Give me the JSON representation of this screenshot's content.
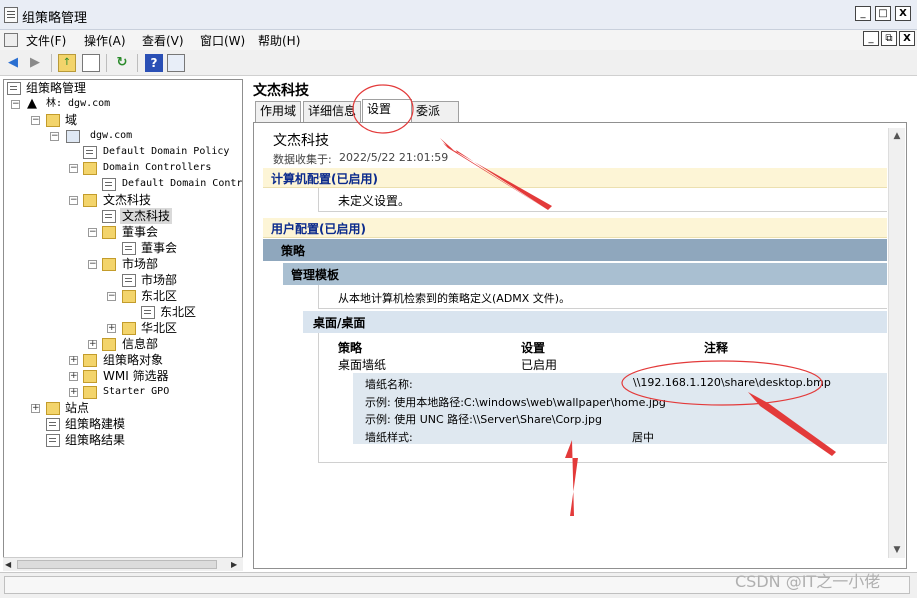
{
  "window": {
    "title": "组策略管理",
    "minimize": "_",
    "maximize": "□",
    "close": "X"
  },
  "menu": {
    "items": [
      "文件(F)",
      "操作(A)",
      "查看(V)",
      "窗口(W)",
      "帮助(H)"
    ],
    "child_minimize": "_",
    "child_restore": "⧉",
    "child_close": "X"
  },
  "toolbar": {
    "icons": [
      "back-arrow-icon",
      "forward-arrow-icon",
      "up-folder-icon",
      "show-tree-icon",
      "refresh-icon",
      "help-icon",
      "properties-icon"
    ]
  },
  "tree": {
    "root": "组策略管理",
    "forest": "林: dgw.com",
    "domains": "域",
    "domain": "dgw.com",
    "default_domain_policy": "Default Domain Policy",
    "domain_controllers": "Domain Controllers",
    "default_domain_controllers_policy": "Default Domain Contr",
    "ou_wenjie": "文杰科技",
    "gpo_wenjie": "文杰科技",
    "ou_board": "董事会",
    "gpo_board": "董事会",
    "ou_market": "市场部",
    "gpo_market": "市场部",
    "ou_northeast": "东北区",
    "gpo_northeast": "东北区",
    "ou_northchina": "华北区",
    "ou_it": "信息部",
    "gpo_objects": "组策略对象",
    "wmi_filters": "WMI 筛选器",
    "starter_gpo": "Starter GPO",
    "sites": "站点",
    "modeling": "组策略建模",
    "results": "组策略结果"
  },
  "details": {
    "title": "文杰科技",
    "tabs": [
      "作用域",
      "详细信息",
      "设置",
      "委派"
    ],
    "active_tab": "设置",
    "report": {
      "title": "文杰科技",
      "collected_label": "数据收集于:",
      "collected_time": "2022/5/22 21:01:59",
      "computer_section": "计算机配置(已启用)",
      "computer_none": "未定义设置。",
      "user_section": "用户配置(已启用)",
      "policies": "策略",
      "admin_templates": "管理模板",
      "admx_note": "从本地计算机检索到的策略定义(ADMX 文件)。",
      "desktop_path": "桌面/桌面",
      "col_policy": "策略",
      "col_setting": "设置",
      "col_comment": "注释",
      "wallpaper_policy": "桌面墙纸",
      "wallpaper_state": "已启用",
      "wallpaper_name_label": "墙纸名称:",
      "wallpaper_name_value": "\\\\192.168.1.120\\share\\desktop.bmp",
      "example_local": "示例: 使用本地路径:C:\\windows\\web\\wallpaper\\home.jpg",
      "example_unc": "示例: 使用  UNC 路径:\\\\Server\\Share\\Corp.jpg",
      "wallpaper_style_label": "墙纸样式:",
      "wallpaper_style_value": "居中"
    }
  },
  "watermark": "CSDN @IT之一小佬",
  "colors": {
    "section_header_bg": "#fdf5d6",
    "section_header_text": "#0b2a8c",
    "policy_bar": "#8fa7bd",
    "template_bar": "#a9bfd1",
    "desktop_bar": "#d9e4ef",
    "annotation_red": "#e33a3a"
  }
}
